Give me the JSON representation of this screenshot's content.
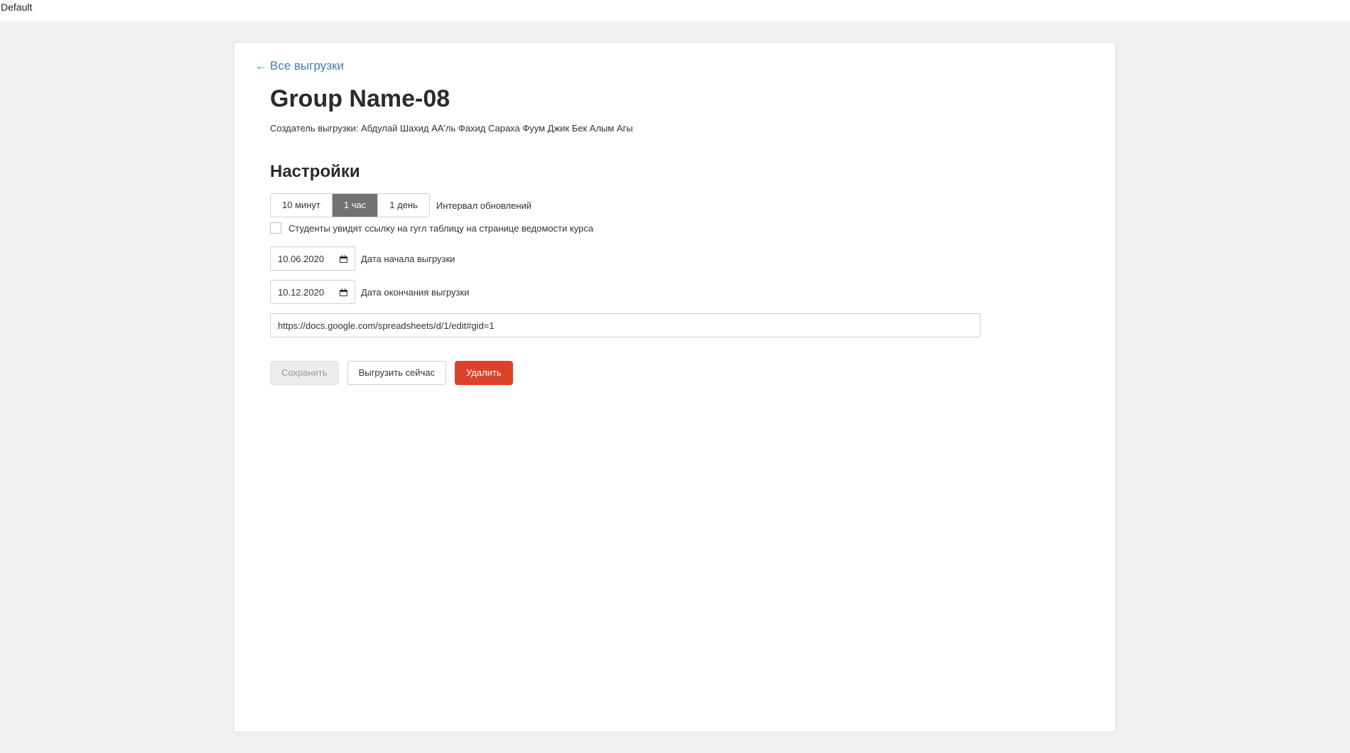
{
  "window": {
    "title": "Default"
  },
  "back_link": {
    "arrow": "←",
    "label": "Все выгрузки"
  },
  "page": {
    "title": "Group Name-08",
    "creator": "Создатель выгрузки: Абдулай Шахид АА'ль Фахид Сараха Фуум Джик Бек Алым Агы"
  },
  "settings": {
    "title": "Настройки",
    "interval": {
      "options": [
        "10 минут",
        "1 час",
        "1 день"
      ],
      "selected": "1 час",
      "label": "Интервал обновлений"
    },
    "students_checkbox": {
      "checked": false,
      "label": "Студенты увидят ссылку на гугл таблицу на странице ведомости курса"
    },
    "start_date": {
      "value": "10.06.2020",
      "label": "Дата начала выгрузки"
    },
    "end_date": {
      "value": "10.12.2020",
      "label": "Дата окончания выгрузки"
    },
    "sheet_url": "https://docs.google.com/spreadsheets/d/1/edit#gid=1"
  },
  "actions": {
    "save_label": "Сохранить",
    "export_label": "Выгрузить сейчас",
    "delete_label": "Удалить"
  },
  "colors": {
    "link": "#3a7ec2",
    "segment_active": "#727272",
    "delete_button": "#d9432a",
    "page_background": "#f1f1f1"
  }
}
